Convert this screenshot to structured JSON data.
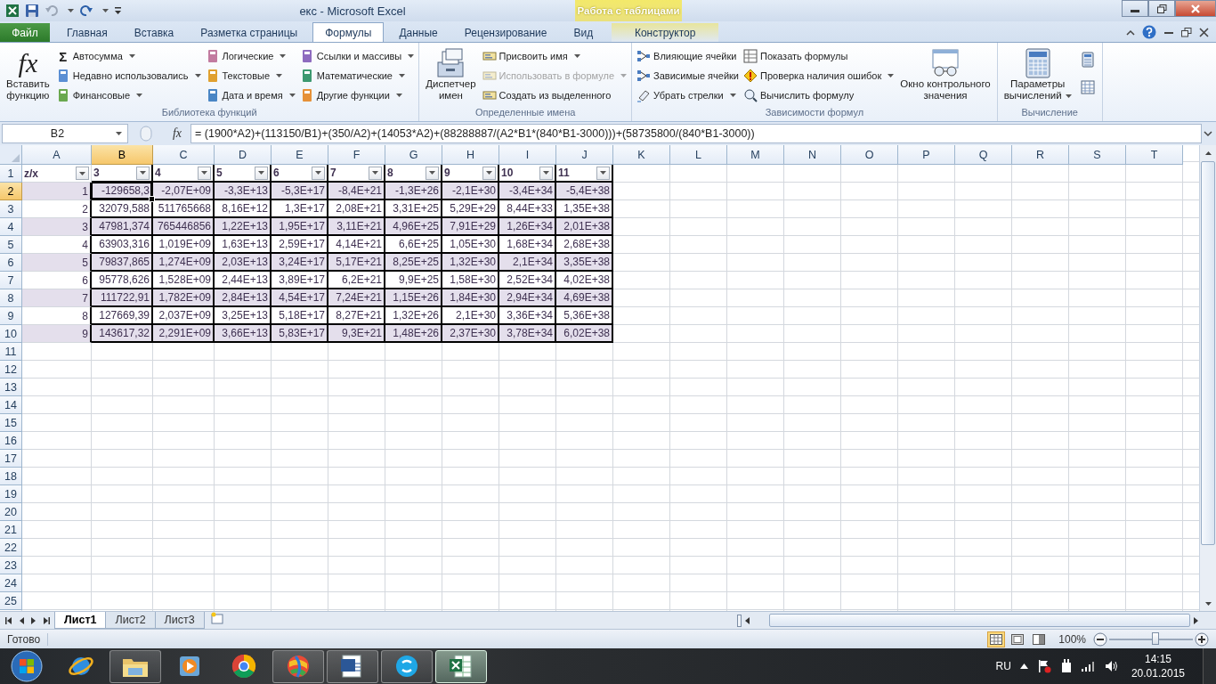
{
  "window": {
    "title": "екс - Microsoft Excel",
    "context_label": "Работа с таблицами"
  },
  "ribbon_tabs": [
    {
      "label": "Файл",
      "kind": "file",
      "selected": false
    },
    {
      "label": "Главная",
      "kind": "tab",
      "selected": false
    },
    {
      "label": "Вставка",
      "kind": "tab",
      "selected": false
    },
    {
      "label": "Разметка страницы",
      "kind": "tab",
      "selected": false
    },
    {
      "label": "Формулы",
      "kind": "tab",
      "selected": true
    },
    {
      "label": "Данные",
      "kind": "tab",
      "selected": false
    },
    {
      "label": "Рецензирование",
      "kind": "tab",
      "selected": false
    },
    {
      "label": "Вид",
      "kind": "tab",
      "selected": false
    },
    {
      "label": "Конструктор",
      "kind": "contextual",
      "selected": false
    }
  ],
  "ribbon": {
    "groups": [
      {
        "label": "Библиотека функций",
        "parts": [
          {
            "kind": "large",
            "glyph": "fx",
            "label": "Вставить\nфункцию",
            "dropdown": false
          },
          {
            "kind": "column",
            "items": [
              {
                "glyph": "Σ",
                "label": "Автосумма",
                "dropdown": true,
                "disabled": false
              },
              {
                "label": "Недавно использовались",
                "dropdown": true,
                "disabled": false
              },
              {
                "label": "Финансовые",
                "dropdown": true,
                "disabled": false
              }
            ]
          },
          {
            "kind": "column",
            "items": [
              {
                "label": "Логические",
                "dropdown": true,
                "disabled": false
              },
              {
                "label": "Текстовые",
                "dropdown": true,
                "disabled": false
              },
              {
                "label": "Дата и время",
                "dropdown": true,
                "disabled": false
              }
            ]
          },
          {
            "kind": "column",
            "items": [
              {
                "label": "Ссылки и массивы",
                "dropdown": true,
                "disabled": false
              },
              {
                "label": "Математические",
                "dropdown": true,
                "disabled": false
              },
              {
                "label": "Другие функции",
                "dropdown": true,
                "disabled": false
              }
            ]
          }
        ]
      },
      {
        "label": "Определенные имена",
        "parts": [
          {
            "kind": "large",
            "label": "Диспетчер\nимен",
            "dropdown": false
          },
          {
            "kind": "column",
            "items": [
              {
                "label": "Присвоить имя",
                "dropdown": true,
                "disabled": false
              },
              {
                "label": "Использовать в формуле",
                "dropdown": true,
                "disabled": true
              },
              {
                "label": "Создать из выделенного",
                "dropdown": false,
                "disabled": false
              }
            ]
          }
        ]
      },
      {
        "label": "Зависимости формул",
        "parts": [
          {
            "kind": "column",
            "items": [
              {
                "label": "Влияющие ячейки",
                "dropdown": false,
                "disabled": false
              },
              {
                "label": "Зависимые ячейки",
                "dropdown": false,
                "disabled": false
              },
              {
                "label": "Убрать стрелки",
                "dropdown": true,
                "disabled": false
              }
            ]
          },
          {
            "kind": "column",
            "items": [
              {
                "label": "Показать формулы",
                "dropdown": false,
                "disabled": false
              },
              {
                "label": "Проверка наличия ошибок",
                "dropdown": true,
                "disabled": false
              },
              {
                "label": "Вычислить формулу",
                "dropdown": false,
                "disabled": false
              }
            ]
          },
          {
            "kind": "large",
            "label": "Окно контрольного\nзначения",
            "dropdown": false
          }
        ]
      },
      {
        "label": "Вычисление",
        "parts": [
          {
            "kind": "large",
            "label": "Параметры\nвычислений",
            "dropdown": true
          },
          {
            "kind": "icon_column"
          }
        ]
      }
    ]
  },
  "formula_bar": {
    "name_box": "B2",
    "fx": "fx",
    "formula": "= (1900*A2)+(113150/B1)+(350/A2)+(14053*A2)+(88288887/(A2*B1*(840*B1-3000)))+(58735800/(840*B1-3000))"
  },
  "sheet": {
    "columns": [
      {
        "label": "A",
        "selected": false
      },
      {
        "label": "B",
        "selected": true
      },
      {
        "label": "C",
        "selected": false
      },
      {
        "label": "D",
        "selected": false
      },
      {
        "label": "E",
        "selected": false
      },
      {
        "label": "F",
        "selected": false
      },
      {
        "label": "G",
        "selected": false
      },
      {
        "label": "H",
        "selected": false
      },
      {
        "label": "I",
        "selected": false
      },
      {
        "label": "J",
        "selected": false
      },
      {
        "label": "K",
        "selected": false
      },
      {
        "label": "L",
        "selected": false
      },
      {
        "label": "M",
        "selected": false
      },
      {
        "label": "N",
        "selected": false
      },
      {
        "label": "O",
        "selected": false
      },
      {
        "label": "P",
        "selected": false
      },
      {
        "label": "Q",
        "selected": false
      },
      {
        "label": "R",
        "selected": false
      },
      {
        "label": "S",
        "selected": false
      },
      {
        "label": "T",
        "selected": false
      }
    ],
    "rows": [
      {
        "label": "1",
        "selected": false,
        "kind": "header",
        "cells": [
          "z/x",
          "3",
          "4",
          "5",
          "6",
          "7",
          "8",
          "9",
          "10",
          "11"
        ]
      },
      {
        "label": "2",
        "selected": true,
        "kind": "data",
        "banded": true,
        "cells": [
          "1",
          "-129658,3",
          "-2,07E+09",
          "-3,3E+13",
          "-5,3E+17",
          "-8,4E+21",
          "-1,3E+26",
          "-2,1E+30",
          "-3,4E+34",
          "-5,4E+38"
        ]
      },
      {
        "label": "3",
        "selected": false,
        "kind": "data",
        "banded": false,
        "cells": [
          "2",
          "32079,588",
          "511765668",
          "8,16E+12",
          "1,3E+17",
          "2,08E+21",
          "3,31E+25",
          "5,29E+29",
          "8,44E+33",
          "1,35E+38"
        ]
      },
      {
        "label": "4",
        "selected": false,
        "kind": "data",
        "banded": true,
        "cells": [
          "3",
          "47981,374",
          "765446856",
          "1,22E+13",
          "1,95E+17",
          "3,11E+21",
          "4,96E+25",
          "7,91E+29",
          "1,26E+34",
          "2,01E+38"
        ]
      },
      {
        "label": "5",
        "selected": false,
        "kind": "data",
        "banded": false,
        "cells": [
          "4",
          "63903,316",
          "1,019E+09",
          "1,63E+13",
          "2,59E+17",
          "4,14E+21",
          "6,6E+25",
          "1,05E+30",
          "1,68E+34",
          "2,68E+38"
        ]
      },
      {
        "label": "6",
        "selected": false,
        "kind": "data",
        "banded": true,
        "cells": [
          "5",
          "79837,865",
          "1,274E+09",
          "2,03E+13",
          "3,24E+17",
          "5,17E+21",
          "8,25E+25",
          "1,32E+30",
          "2,1E+34",
          "3,35E+38"
        ]
      },
      {
        "label": "7",
        "selected": false,
        "kind": "data",
        "banded": false,
        "cells": [
          "6",
          "95778,626",
          "1,528E+09",
          "2,44E+13",
          "3,89E+17",
          "6,2E+21",
          "9,9E+25",
          "1,58E+30",
          "2,52E+34",
          "4,02E+38"
        ]
      },
      {
        "label": "8",
        "selected": false,
        "kind": "data",
        "banded": true,
        "cells": [
          "7",
          "111722,91",
          "1,782E+09",
          "2,84E+13",
          "4,54E+17",
          "7,24E+21",
          "1,15E+26",
          "1,84E+30",
          "2,94E+34",
          "4,69E+38"
        ]
      },
      {
        "label": "9",
        "selected": false,
        "kind": "data",
        "banded": false,
        "cells": [
          "8",
          "127669,39",
          "2,037E+09",
          "3,25E+13",
          "5,18E+17",
          "8,27E+21",
          "1,32E+26",
          "2,1E+30",
          "3,36E+34",
          "5,36E+38"
        ]
      },
      {
        "label": "10",
        "selected": false,
        "kind": "data",
        "banded": true,
        "cells": [
          "9",
          "143617,32",
          "2,291E+09",
          "3,66E+13",
          "5,83E+17",
          "9,3E+21",
          "1,48E+26",
          "2,37E+30",
          "3,78E+34",
          "6,02E+38"
        ]
      },
      {
        "label": "11",
        "selected": false
      },
      {
        "label": "12",
        "selected": false
      },
      {
        "label": "13",
        "selected": false
      },
      {
        "label": "14",
        "selected": false
      },
      {
        "label": "15",
        "selected": false
      },
      {
        "label": "16",
        "selected": false
      },
      {
        "label": "17",
        "selected": false
      },
      {
        "label": "18",
        "selected": false
      },
      {
        "label": "19",
        "selected": false
      },
      {
        "label": "20",
        "selected": false
      },
      {
        "label": "21",
        "selected": false
      },
      {
        "label": "22",
        "selected": false
      },
      {
        "label": "23",
        "selected": false
      },
      {
        "label": "24",
        "selected": false
      },
      {
        "label": "25",
        "selected": false
      }
    ]
  },
  "sheet_tabs": [
    {
      "label": "Лист1",
      "selected": true
    },
    {
      "label": "Лист2",
      "selected": false
    },
    {
      "label": "Лист3",
      "selected": false
    }
  ],
  "status_bar": {
    "text": "Готово",
    "view_buttons": [
      {
        "selected": true
      },
      {
        "selected": false
      },
      {
        "selected": false
      }
    ],
    "zoom": {
      "label": "100%",
      "level": 0.55
    }
  },
  "taskbar": {
    "apps": [
      {
        "running": false,
        "selected": false
      },
      {
        "running": true,
        "selected": false
      },
      {
        "running": false,
        "selected": false
      },
      {
        "running": false,
        "selected": false
      },
      {
        "running": true,
        "selected": false
      },
      {
        "running": true,
        "selected": false
      },
      {
        "running": true,
        "selected": false
      },
      {
        "running": true,
        "selected": true
      }
    ],
    "language": "RU",
    "time": "14:15",
    "date": "20.01.2015"
  }
}
